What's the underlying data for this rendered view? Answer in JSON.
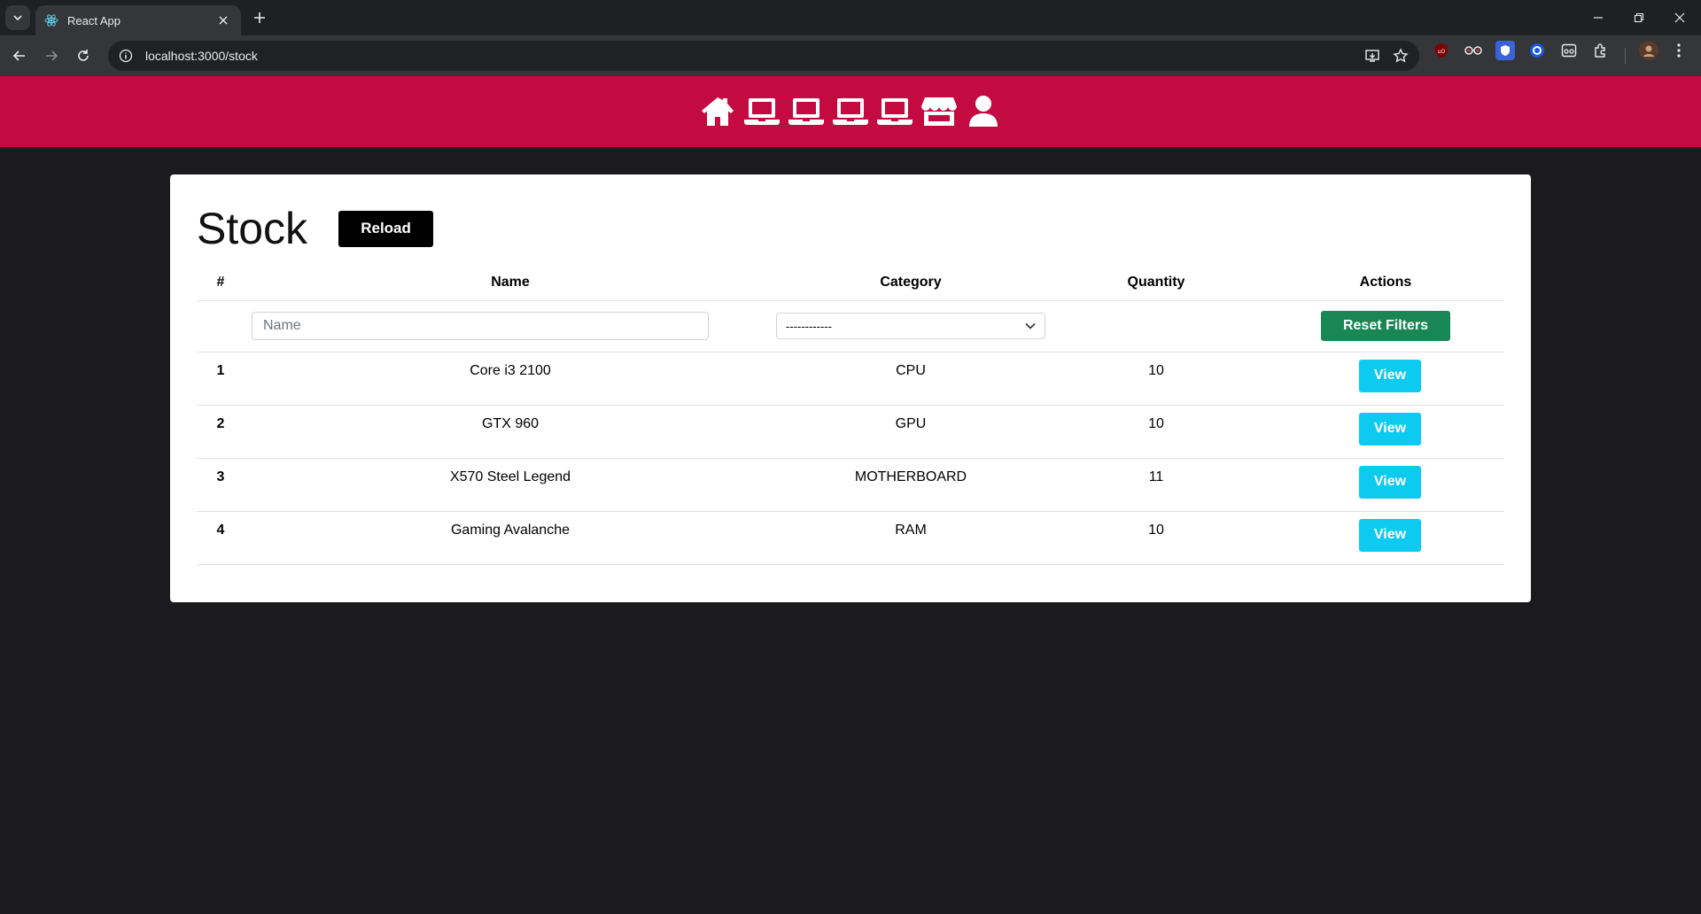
{
  "browser": {
    "tab_title": "React App",
    "url": "localhost:3000/stock"
  },
  "nav": {
    "background": "#c30a41",
    "icons": [
      "home-icon",
      "laptop-icon",
      "laptop-icon",
      "laptop-icon",
      "laptop-icon",
      "store-icon",
      "user-icon"
    ]
  },
  "page": {
    "title": "Stock",
    "reload_label": "Reload"
  },
  "table": {
    "headers": {
      "index": "#",
      "name": "Name",
      "category": "Category",
      "quantity": "Quantity",
      "actions": "Actions"
    },
    "filters": {
      "name_placeholder": "Name",
      "category_selected": "------------",
      "reset_label": "Reset Filters"
    },
    "rows": [
      {
        "index": "1",
        "name": "Core i3 2100",
        "category": "CPU",
        "quantity": "10",
        "action": "View"
      },
      {
        "index": "2",
        "name": "GTX 960",
        "category": "GPU",
        "quantity": "10",
        "action": "View"
      },
      {
        "index": "3",
        "name": "X570 Steel Legend",
        "category": "MOTHERBOARD",
        "quantity": "11",
        "action": "View"
      },
      {
        "index": "4",
        "name": "Gaming Avalanche",
        "category": "RAM",
        "quantity": "10",
        "action": "View"
      }
    ]
  },
  "colors": {
    "reload": "#000000",
    "reset": "#198754",
    "view": "#0dcaf0"
  }
}
